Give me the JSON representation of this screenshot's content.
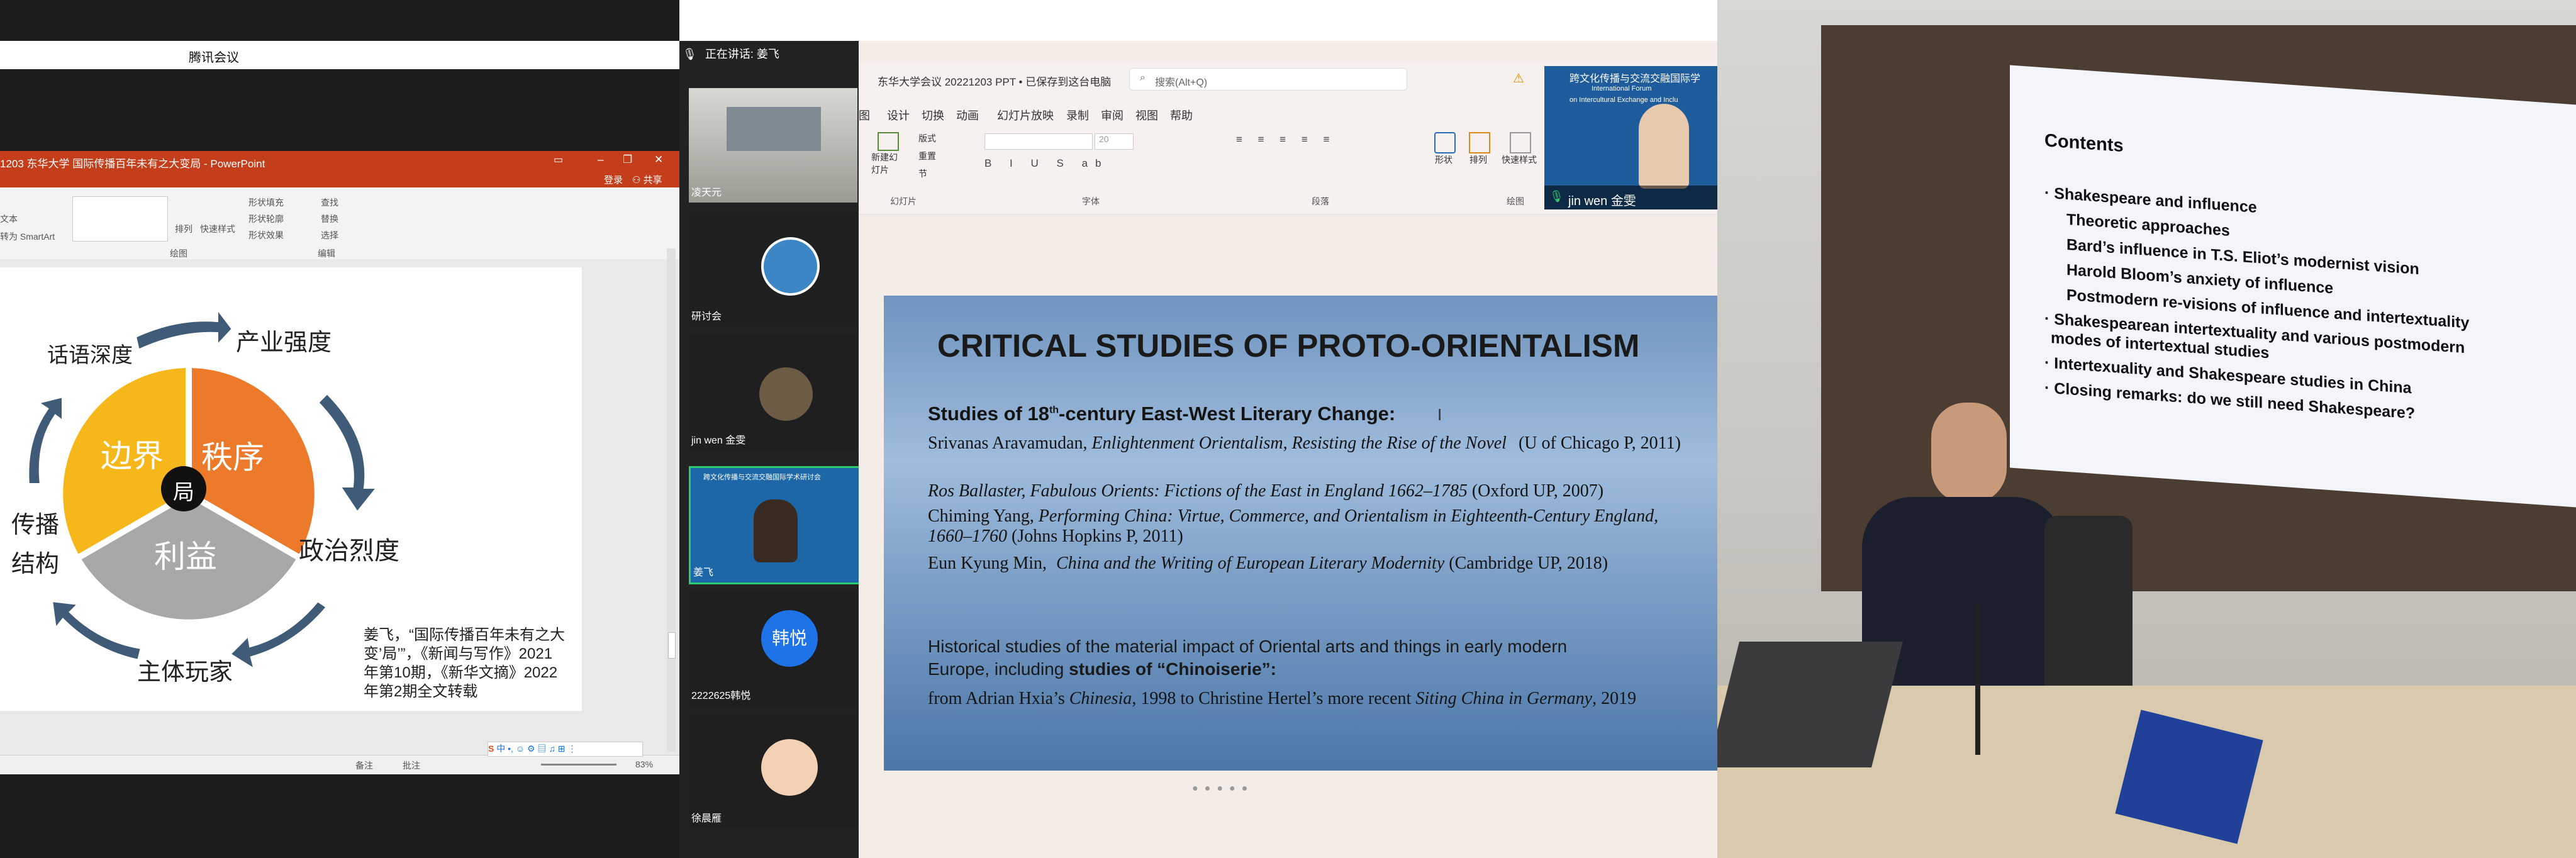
{
  "meeting": {
    "app_title": "腾讯会议",
    "speaking_label": "正在讲话: 姜飞"
  },
  "ppt": {
    "window_title": "1203 东华大学 国际传播百年未有之大变局 - PowerPoint",
    "login": "登录",
    "share": "共享",
    "ribbon_group_drawing": "绘图",
    "ribbon_group_edit": "编辑",
    "ribbon_buttons": [
      "排列",
      "快速样式",
      "形状填充",
      "形状轮廓",
      "形状效果",
      "查找",
      "替换",
      "选择"
    ],
    "convert_smartart": "转为 SmartArt",
    "text_label": "文本",
    "slide": {
      "center_label": "局",
      "seg_border": "边界",
      "seg_order": "秩序",
      "seg_interest": "利益",
      "label_discourse": "话语深度",
      "label_industry": "产业强度",
      "label_politics": "政治烈度",
      "label_players": "主体玩家",
      "label_spread1": "传播",
      "label_spread2": "结构",
      "citation": "姜飞，“国际传播百年未有之大变’局’”，《新闻与写作》2021年第10期，《新华文摘》2022年第2期全文转载"
    },
    "status": {
      "notes": "备注",
      "comments": "批注",
      "zoom": "83%"
    }
  },
  "participants": [
    {
      "name": "凌天元"
    },
    {
      "name": "研讨会"
    },
    {
      "name": "jin wen 金雯"
    },
    {
      "name": "姜飞",
      "banner": "跨文化传播与交流交融国际学术研讨会"
    },
    {
      "name": "2222625韩悦",
      "avatar_text": "韩悦"
    },
    {
      "name": "徐晨雁"
    }
  ],
  "share": {
    "file_title": "东华大学会议 20221203 PPT • 已保存到这台电脑",
    "search_placeholder": "搜索(Alt+Q)",
    "tabs": [
      "图",
      "设计",
      "切换",
      "动画",
      "幻灯片放映",
      "录制",
      "审阅",
      "视图",
      "帮助"
    ],
    "ribbon": {
      "new_slide": "新建幻灯片",
      "layout": "版式",
      "reset": "重置",
      "section": "节",
      "slides_group": "幻灯片",
      "font_group": "字体",
      "paragraph_group": "段落",
      "drawing_group": "绘图",
      "shape": "形状",
      "arrange": "排列",
      "quick_style": "快速样式",
      "font_size": "20"
    },
    "presenter": {
      "name": "jin wen 金雯",
      "banner_cn": "跨文化传播与交流交融国际学",
      "banner_en1": "International Forum",
      "banner_en2": "on Intercultural Exchange and Inclu"
    },
    "slide": {
      "title": "CRITICAL STUDIES OF PROTO-ORIENTALISM",
      "heading1_pre": "Studies of 18",
      "heading1_sup": "th",
      "heading1_post": "-century East-West Literary Change:",
      "ref1_author": "Srivanas Aravamudan,",
      "ref1_title": "Enlightenment Orientalism, Resisting the Rise of the Novel",
      "ref1_pub": "(U of Chicago P, 2011)",
      "ref2": "Ros Ballaster, Fabulous Orients: Fictions of the East in England 1662–1785",
      "ref2_pub": "(Oxford UP, 2007)",
      "ref3_author": "Chiming Yang,",
      "ref3_title": "Performing China: Virtue, Commerce, and Orientalism in Eighteenth-Century England, 1660–1760",
      "ref3_pub": "(Johns Hopkins P, 2011)",
      "ref4_author": "Eun Kyung Min,",
      "ref4_title": "China and the Writing of European Literary Modernity",
      "ref4_pub": "(Cambridge UP, 2018)",
      "heading2a": "Historical studies of the material impact of Oriental arts and things in early modern",
      "heading2b_pre": "Europe, including",
      "heading2b_bold": "studies of “Chinoiserie”:",
      "last_pre": "from Adrian Hxia’s",
      "last_i1": "Chinesia",
      "last_mid": ", 1998 to Christine Hertel’s more recent",
      "last_i2": "Siting China in Germany",
      "last_post": ", 2019"
    }
  },
  "photo": {
    "contents_title": "Contents",
    "items": [
      "· Shakespeare and influence",
      "Theoretic approaches",
      "Bard’s influence in T.S. Eliot’s modernist vision",
      "Harold Bloom’s anxiety of influence",
      "Postmodern re-visions of influence and intertextuality",
      "· Shakespearean intertextuality and various postmodern",
      "modes of intertextual studies",
      "· Intertexuality and Shakespeare studies in China",
      "· Closing remarks: do we still need Shakespeare?"
    ]
  },
  "colors": {
    "ppt_red": "#c43e1c",
    "segment_orange": "#ec7a2a",
    "segment_yellow": "#f6b71a",
    "segment_gray": "#a8a8a8",
    "arrow_blue": "#4a6a8a"
  }
}
